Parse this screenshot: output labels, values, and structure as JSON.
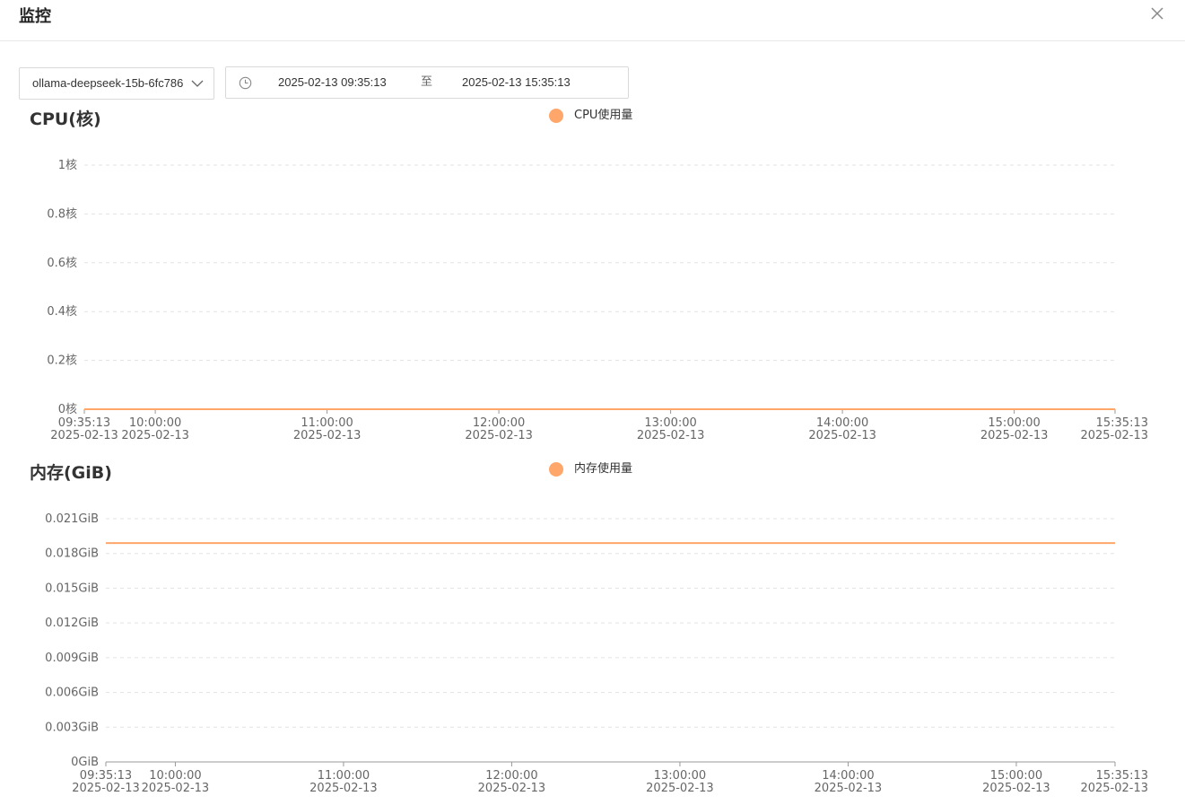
{
  "modal": {
    "title": "监控"
  },
  "filters": {
    "pod_select": {
      "value": "ollama-deepseek-15b-6fc786"
    },
    "time_range": {
      "start": "2025-02-13 09:35:13",
      "separator": "至",
      "end": "2025-02-13 15:35:13"
    }
  },
  "colors": {
    "series": "#ffa76b",
    "grid": "#e3e3e3",
    "axis": "#999999"
  },
  "icons": {
    "close": "close-icon",
    "dropdown": "chevron-down-icon",
    "clock": "clock-icon"
  },
  "chart_data": [
    {
      "type": "line",
      "title": "CPU(核)",
      "legend": {
        "placement": "top-center"
      },
      "grid": true,
      "xlim": [
        "2025-02-13 09:35:13",
        "2025-02-13 15:35:13"
      ],
      "x_ticks": [
        {
          "time": "09:35:13",
          "date": "2025-02-13"
        },
        {
          "time": "10:00:00",
          "date": "2025-02-13"
        },
        {
          "time": "11:00:00",
          "date": "2025-02-13"
        },
        {
          "time": "12:00:00",
          "date": "2025-02-13"
        },
        {
          "time": "13:00:00",
          "date": "2025-02-13"
        },
        {
          "time": "14:00:00",
          "date": "2025-02-13"
        },
        {
          "time": "15:00:00",
          "date": "2025-02-13"
        },
        {
          "time": "15:35:13",
          "date": "2025-02-13"
        }
      ],
      "ylim": [
        0,
        1
      ],
      "y_ticks": [
        "0核",
        "0.2核",
        "0.4核",
        "0.6核",
        "0.8核",
        "1核"
      ],
      "series": [
        {
          "name": "CPU使用量",
          "x": [
            "2025-02-13 09:35:13",
            "2025-02-13 15:35:13"
          ],
          "values": [
            0,
            0
          ]
        }
      ]
    },
    {
      "type": "line",
      "title": "内存(GiB)",
      "legend": {
        "placement": "top-center"
      },
      "grid": true,
      "xlim": [
        "2025-02-13 09:35:13",
        "2025-02-13 15:35:13"
      ],
      "x_ticks": [
        {
          "time": "09:35:13",
          "date": "2025-02-13"
        },
        {
          "time": "10:00:00",
          "date": "2025-02-13"
        },
        {
          "time": "11:00:00",
          "date": "2025-02-13"
        },
        {
          "time": "12:00:00",
          "date": "2025-02-13"
        },
        {
          "time": "13:00:00",
          "date": "2025-02-13"
        },
        {
          "time": "14:00:00",
          "date": "2025-02-13"
        },
        {
          "time": "15:00:00",
          "date": "2025-02-13"
        },
        {
          "time": "15:35:13",
          "date": "2025-02-13"
        }
      ],
      "ylim": [
        0,
        0.021
      ],
      "y_ticks": [
        "0GiB",
        "0.003GiB",
        "0.006GiB",
        "0.009GiB",
        "0.012GiB",
        "0.015GiB",
        "0.018GiB",
        "0.021GiB"
      ],
      "series": [
        {
          "name": "内存使用量",
          "x": [
            "2025-02-13 09:35:13",
            "2025-02-13 15:35:13"
          ],
          "values": [
            0.0189,
            0.0189
          ]
        }
      ]
    }
  ]
}
